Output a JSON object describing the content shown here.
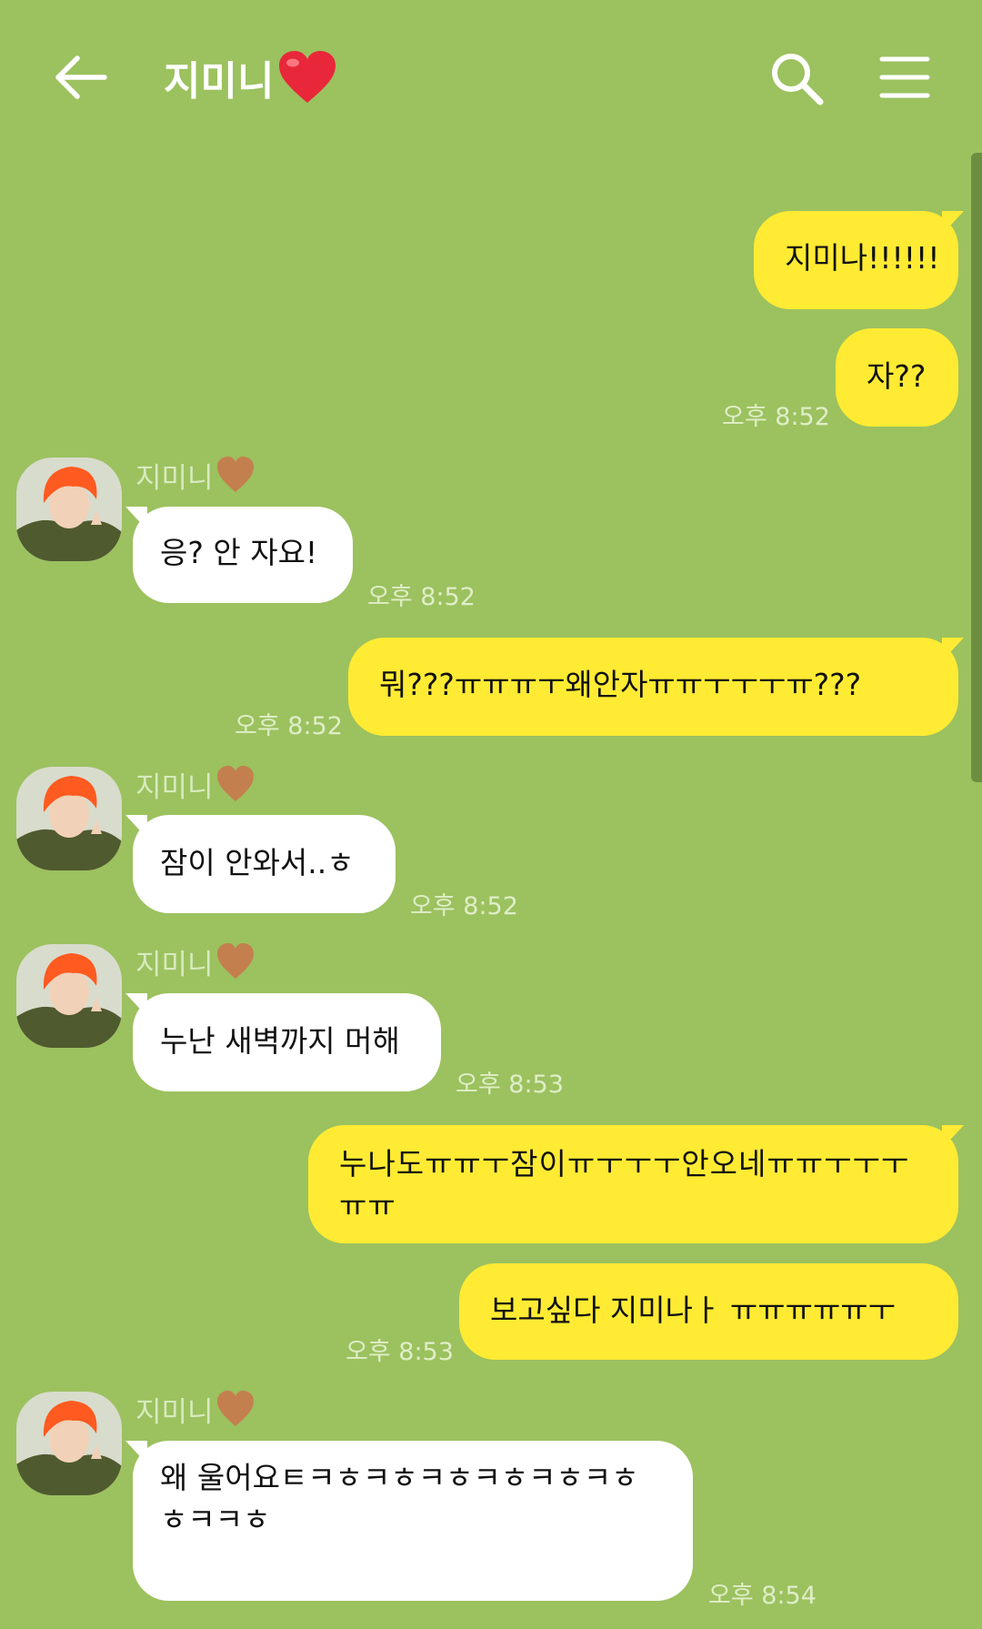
{
  "header": {
    "title": "지미니",
    "back_icon": "arrow-left-icon",
    "search_icon": "search-icon",
    "menu_icon": "menu-icon",
    "title_heart_color": "#e8283a"
  },
  "colors": {
    "background": "#9cc15f",
    "my_bubble": "#ffeb33",
    "their_bubble": "#ffffff",
    "sender_heart": "#c47f4f"
  },
  "chat": {
    "sender_name": "지미니",
    "messages": [
      {
        "from": "me",
        "text": "지미나!!!!!!",
        "time": ""
      },
      {
        "from": "me",
        "text": "자??",
        "time": "오후 8:52"
      },
      {
        "from": "them",
        "text": "응? 안 자요!",
        "time": "오후 8:52"
      },
      {
        "from": "me",
        "text": "뭐???ㅠㅠㅠㅜ왜안자ㅠㅠㅜㅜㅜㅠ???",
        "time": "오후 8:52"
      },
      {
        "from": "them",
        "text": "잠이 안와서..ㅎ",
        "time": "오후 8:52"
      },
      {
        "from": "them",
        "text": "누난 새벽까지 머해",
        "time": "오후 8:53"
      },
      {
        "from": "me",
        "text": "누나도ㅠㅠㅜ잠이ㅠㅜㅜㅜ안오네ㅠㅠㅜㅜㅜㅠㅠ",
        "time": ""
      },
      {
        "from": "me",
        "text": "보고싶다 지미나ㅏ ㅠㅠㅠㅠㅠㅜ",
        "time": "오후 8:53"
      },
      {
        "from": "them",
        "text": "왜 울어요ㅌㅋㅎㅋㅎㅋㅎㅋㅎㅋㅎㅋㅎㅎㅋㅋㅎ",
        "time": "오후 8:54"
      }
    ]
  }
}
